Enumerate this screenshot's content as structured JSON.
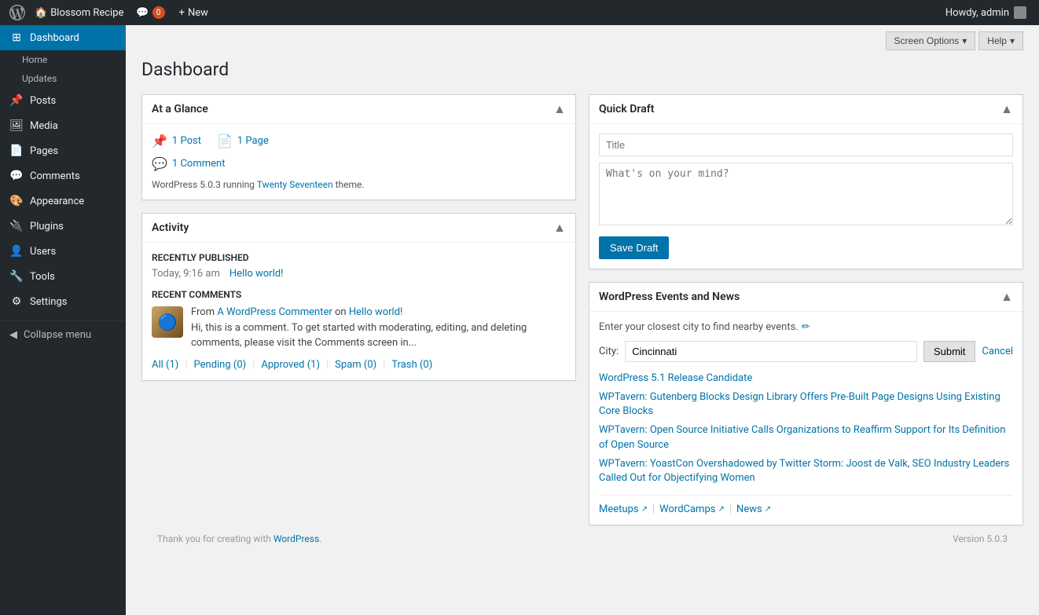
{
  "adminbar": {
    "logo_label": "WordPress",
    "site_name": "Blossom Recipe",
    "comments_count": "0",
    "new_label": "New",
    "howdy": "Howdy, admin",
    "screen_options": "Screen Options",
    "help": "Help"
  },
  "sidebar": {
    "active": "Dashboard",
    "items": [
      {
        "id": "dashboard",
        "label": "Dashboard",
        "icon": "🏠"
      },
      {
        "id": "home",
        "label": "Home",
        "sub": true
      },
      {
        "id": "updates",
        "label": "Updates",
        "sub": true
      },
      {
        "id": "posts",
        "label": "Posts",
        "icon": "📌"
      },
      {
        "id": "media",
        "label": "Media",
        "icon": "🖼"
      },
      {
        "id": "pages",
        "label": "Pages",
        "icon": "📄"
      },
      {
        "id": "comments",
        "label": "Comments",
        "icon": "💬"
      },
      {
        "id": "appearance",
        "label": "Appearance",
        "icon": "🎨"
      },
      {
        "id": "plugins",
        "label": "Plugins",
        "icon": "🔌"
      },
      {
        "id": "users",
        "label": "Users",
        "icon": "👤"
      },
      {
        "id": "tools",
        "label": "Tools",
        "icon": "🔧"
      },
      {
        "id": "settings",
        "label": "Settings",
        "icon": "⚙"
      }
    ],
    "collapse_label": "Collapse menu"
  },
  "page": {
    "title": "Dashboard"
  },
  "at_a_glance": {
    "title": "At a Glance",
    "posts_count": "1 Post",
    "pages_count": "1 Page",
    "comments_count": "1 Comment",
    "wp_version": "WordPress 5.0.3",
    "theme_text": "running",
    "theme_name": "Twenty Seventeen",
    "theme_suffix": "theme."
  },
  "activity": {
    "title": "Activity",
    "recently_published_label": "Recently Published",
    "pub_time": "Today, 9:16 am",
    "pub_post": "Hello world!",
    "recent_comments_label": "Recent Comments",
    "comment_from": "From",
    "commenter": "A WordPress Commenter",
    "comment_on": "on",
    "comment_post": "Hello world!",
    "comment_text": "Hi, this is a comment. To get started with moderating, editing, and deleting comments, please visit the Comments screen in...",
    "filter_all": "All (1)",
    "filter_pending": "Pending (0)",
    "filter_approved": "Approved (1)",
    "filter_spam": "Spam (0)",
    "filter_trash": "Trash (0)"
  },
  "quick_draft": {
    "title": "Quick Draft",
    "title_placeholder": "Title",
    "body_placeholder": "What's on your mind?",
    "save_label": "Save Draft"
  },
  "wp_events": {
    "title": "WordPress Events and News",
    "intro": "Enter your closest city to find nearby events.",
    "city_label": "City:",
    "city_value": "Cincinnati",
    "submit_label": "Submit",
    "cancel_label": "Cancel",
    "news": [
      {
        "id": "n1",
        "text": "WordPress 5.1 Release Candidate"
      },
      {
        "id": "n2",
        "text": "WPTavern: Gutenberg Blocks Design Library Offers Pre-Built Page Designs Using Existing Core Blocks"
      },
      {
        "id": "n3",
        "text": "WPTavern: Open Source Initiative Calls Organizations to Reaffirm Support for Its Definition of Open Source"
      },
      {
        "id": "n4",
        "text": "WPTavern: YoastCon Overshadowed by Twitter Storm: Joost de Valk, SEO Industry Leaders Called Out for Objectifying Women"
      }
    ],
    "meetups_label": "Meetups",
    "wordcamps_label": "WordCamps",
    "news_label": "News"
  },
  "footer": {
    "thank_you": "Thank you for creating with",
    "wp_link": "WordPress",
    "version": "Version 5.0.3"
  }
}
